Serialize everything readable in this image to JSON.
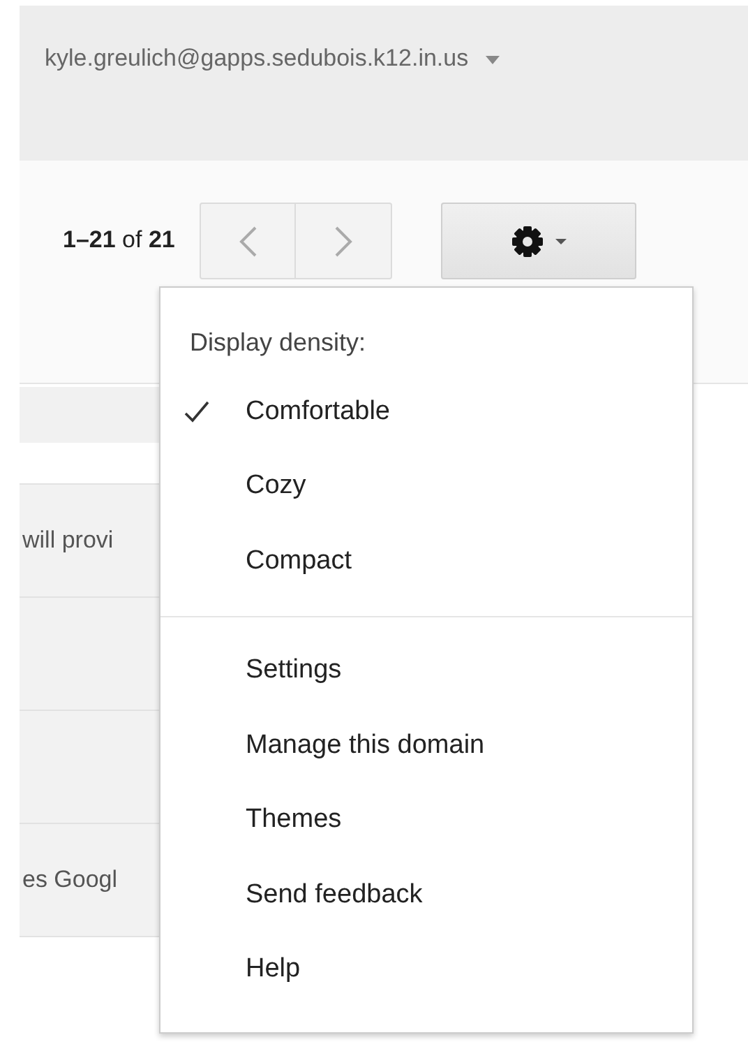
{
  "account": {
    "email": "kyle.greulich@gapps.sedubois.k12.in.us"
  },
  "pagination": {
    "range": "**1–21** of **21**"
  },
  "message_rows": [
    {
      "kind": "text",
      "snippet": "will provi"
    },
    {
      "kind": "blank"
    },
    {
      "kind": "blank"
    },
    {
      "kind": "text",
      "snippet": "es Googl"
    }
  ],
  "settings_menu": {
    "heading": "Display density:",
    "density_options": [
      {
        "label": "Comfortable",
        "selected": true
      },
      {
        "label": "Cozy",
        "selected": false
      },
      {
        "label": "Compact",
        "selected": false
      }
    ],
    "items": [
      "Settings",
      "Manage this domain",
      "Themes",
      "Send feedback",
      "Help"
    ]
  }
}
